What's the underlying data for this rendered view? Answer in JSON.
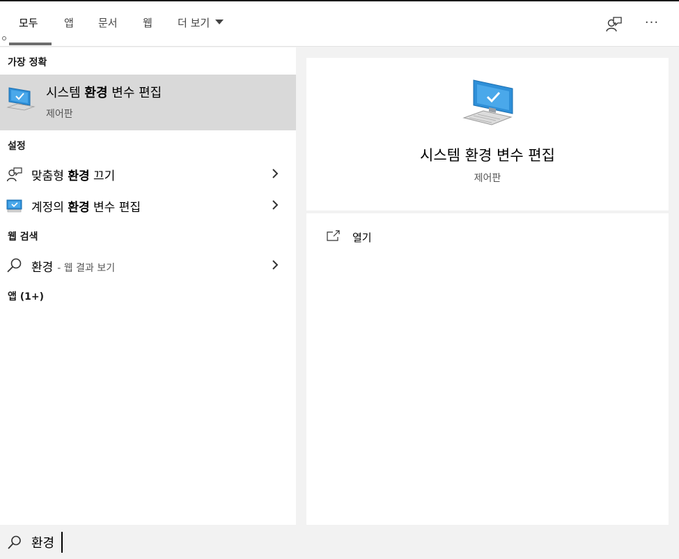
{
  "tabs": [
    {
      "label": "모두",
      "active": true
    },
    {
      "label": "앱"
    },
    {
      "label": "문서"
    },
    {
      "label": "웹"
    },
    {
      "label": "더 보기"
    }
  ],
  "header_icons": {
    "feedback": "feedback-icon",
    "more": "more-options-icon",
    "more_glyph": "···"
  },
  "sections": {
    "best_match": "가장 정확",
    "settings": "설정",
    "web_search": "웹 검색",
    "apps": "앱 (1+)"
  },
  "best_match_item": {
    "title_prefix": "시스템 ",
    "title_bold": "환경",
    "title_suffix": " 변수 편집",
    "subtitle": "제어판",
    "icon": "monitor-check-icon"
  },
  "settings_items": [
    {
      "prefix": "맞춤형 ",
      "bold": "환경",
      "suffix": " 끄기",
      "icon": "person-feedback-icon"
    },
    {
      "prefix": "계정의 ",
      "bold": "환경",
      "suffix": " 변수 편집",
      "icon": "monitor-icon"
    }
  ],
  "web_item": {
    "query": "환경",
    "suffix": "- 웹 결과 보기",
    "icon": "search-icon"
  },
  "preview": {
    "title": "시스템 환경 변수 편집",
    "subtitle": "제어판",
    "icon": "monitor-check-icon",
    "action_label": "열기",
    "action_icon": "open-external-icon"
  },
  "search": {
    "value": "환경",
    "icon": "search-icon"
  },
  "colors": {
    "highlight": "#d9d9d9",
    "panel": "#ffffff",
    "background": "#f2f2f2",
    "monitor_blue": "#2e8fd8"
  }
}
